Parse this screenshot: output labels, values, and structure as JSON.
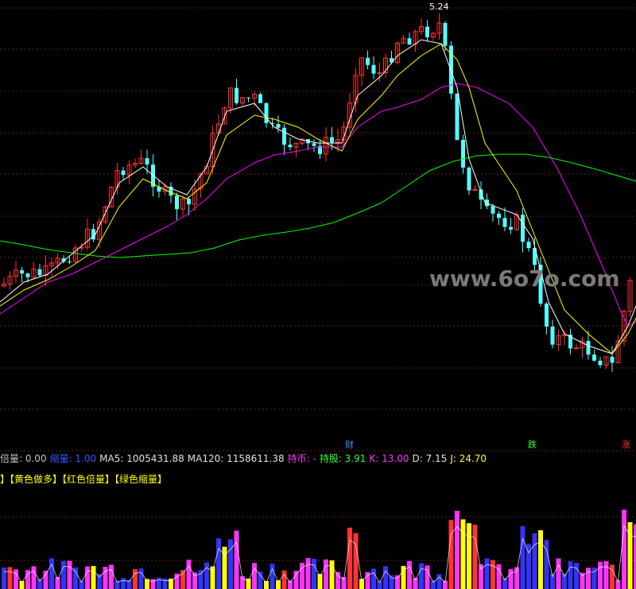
{
  "chart_data": {
    "type": "candlestick",
    "high_label": "5.24",
    "watermark": "www.6o7o.com",
    "info": [
      {
        "label": "倍量:",
        "value": "0.00",
        "color": "#c0c0c0"
      },
      {
        "label": "缩量:",
        "value": "1.00",
        "color": "#3355ff"
      },
      {
        "label": "MA5:",
        "value": "1005431.88",
        "color": "#e0e0e0"
      },
      {
        "label": "MA120:",
        "value": "1158611.38",
        "color": "#e0e0e0"
      },
      {
        "label": "持币:",
        "value": "-",
        "color": "#ff33ff"
      },
      {
        "label": "持股:",
        "value": "3.91",
        "color": "#33ff33"
      },
      {
        "label": "K:",
        "value": "13.00",
        "color": "#ff33ff"
      },
      {
        "label": "D:",
        "value": "7.15",
        "color": "#e0e0e0"
      },
      {
        "label": "J:",
        "value": "24.70",
        "color": "#ffff33"
      }
    ],
    "legend": [
      "】",
      "【黄色做多】",
      "【红色倍量】",
      "【绿色缩量】"
    ],
    "markers": [
      {
        "text": "财",
        "color": "#3399ff"
      },
      {
        "text": "跌",
        "color": "#33ff33"
      },
      {
        "text": "涨",
        "color": "#ff3333"
      }
    ],
    "colors": {
      "up": "#ff3232",
      "down": "#54ffff",
      "ma_short": "#ffffff",
      "ma_mid": "#ffff00",
      "ma_long": "#ff00ff",
      "ma_longest": "#00ff00"
    }
  }
}
